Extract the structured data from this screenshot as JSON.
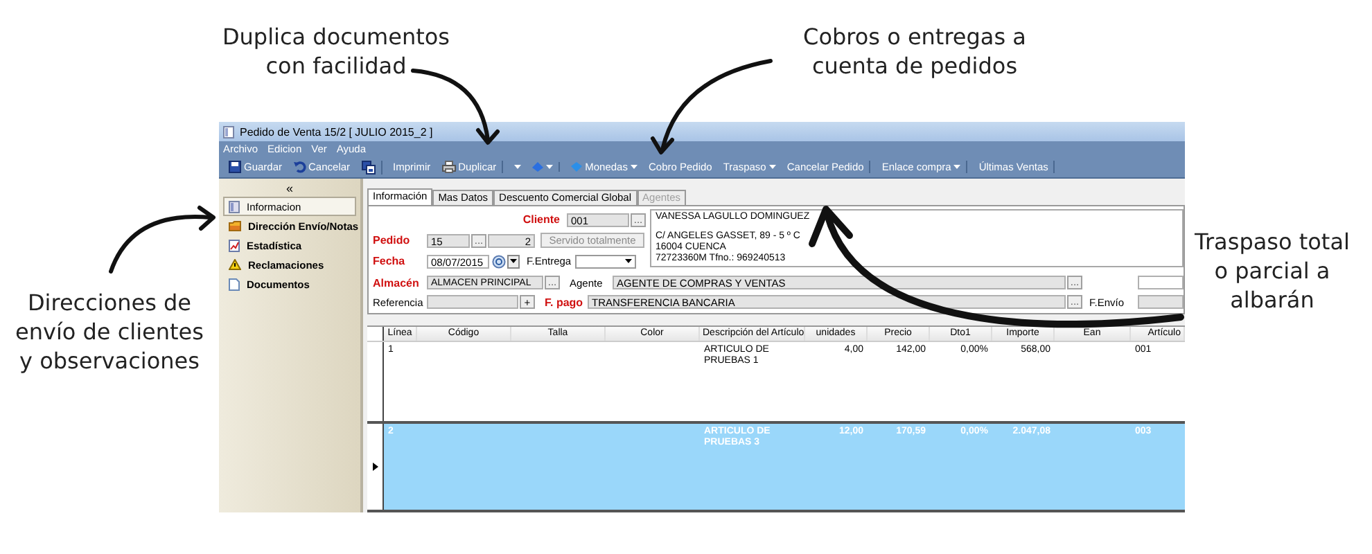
{
  "callouts": [
    {
      "lines": [
        "Duplica documentos",
        "con facilidad"
      ]
    },
    {
      "lines": [
        "Cobros o entregas a",
        "cuenta de pedidos"
      ]
    },
    {
      "lines": [
        "Traspaso total",
        "o parcial a",
        "albarán"
      ]
    },
    {
      "lines": [
        "Direcciones de",
        "envío de clientes",
        "y observaciones"
      ]
    }
  ],
  "window": {
    "title": "Pedido de Venta 15/2 [ JULIO 2015_2 ]"
  },
  "menu": [
    "Archivo",
    "Edicion",
    "Ver",
    "Ayuda"
  ],
  "toolbar": [
    {
      "label": "Guardar",
      "has_menu": false,
      "separator_after": false
    },
    {
      "label": "Cancelar",
      "has_menu": false,
      "separator_after": false
    },
    {
      "has_menu": false,
      "separator_after": true
    },
    {
      "label": "Imprimir",
      "has_menu": false,
      "separator_after": false
    },
    {
      "label": "Duplicar",
      "has_menu": false,
      "separator_after": true
    },
    {
      "has_menu": true,
      "separator_after": false
    },
    {
      "has_menu": true,
      "separator_after": true
    },
    {
      "label": "Monedas",
      "has_menu": true,
      "separator_after": false
    },
    {
      "label": "Cobro Pedido",
      "has_menu": false,
      "separator_after": false
    },
    {
      "label": "Traspaso",
      "has_menu": true,
      "separator_after": false
    },
    {
      "label": "Cancelar Pedido",
      "has_menu": false,
      "separator_after": true
    },
    {
      "label": "Enlace compra",
      "has_menu": true,
      "separator_after": true
    },
    {
      "label": "Últimas Ventas",
      "has_menu": false,
      "separator_after": true
    }
  ],
  "sidebar": {
    "collapse": "«",
    "items": [
      {
        "label": "Informacion",
        "selected": true
      },
      {
        "label": "Dirección Envío/Notas",
        "selected": false
      },
      {
        "label": "Estadística",
        "selected": false
      },
      {
        "label": "Reclamaciones",
        "selected": false
      },
      {
        "label": "Documentos",
        "selected": false
      }
    ]
  },
  "tabs": [
    {
      "label": "Información",
      "selected": true,
      "disabled": false
    },
    {
      "label": "Mas Datos",
      "selected": false,
      "disabled": false
    },
    {
      "label": "Descuento Comercial Global",
      "selected": false,
      "disabled": false
    },
    {
      "label": "Agentes",
      "selected": false,
      "disabled": true
    }
  ],
  "form": {
    "client": {
      "label": "Cliente",
      "required": true,
      "value": "001",
      "button": "..."
    },
    "address": [
      "VANESSA LAGULLO DOMINGUEZ",
      "C/ ANGELES GASSET, 89 - 5 º C",
      "16004 CUENCA",
      "72723360M   Tfno.: 969240513"
    ],
    "order": {
      "label": "Pedido",
      "required": true,
      "series": "15",
      "button": "...",
      "number": "2",
      "status_button": {
        "label": "Servido totalmente",
        "disabled": true
      }
    },
    "date": {
      "label": "Fecha",
      "required": true,
      "value": "08/07/2015"
    },
    "delivery_date": {
      "label": "F.Entrega",
      "required": false
    },
    "warehouse": {
      "label": "Almacén",
      "required": true,
      "value": "ALMACEN PRINCIPAL",
      "button": "..."
    },
    "agent": {
      "label": "Agente",
      "required": false,
      "value": "AGENTE DE COMPRAS Y VENTAS",
      "button": "..."
    },
    "reference": {
      "label": "Referencia",
      "required": false,
      "button": "+"
    },
    "payment": {
      "label": "F. pago",
      "required": true,
      "value": "TRANSFERENCIA BANCARIA",
      "button": "..."
    },
    "ship_date": {
      "label": "F.Envío",
      "required": false
    }
  },
  "grid": {
    "columns": [
      "Línea",
      "Código",
      "Talla",
      "Color",
      "Descripción del Artículo",
      "unidades",
      "Precio",
      "Dto1",
      "Importe",
      "Ean",
      "Artículo"
    ],
    "rows": [
      {
        "selected": false,
        "cells": [
          "1",
          null,
          null,
          null,
          "ARTICULO DE PRUEBAS 1",
          "4,00",
          "142,00",
          "0,00%",
          "568,00",
          null,
          "001"
        ]
      },
      {
        "selected": true,
        "cells": [
          "2",
          null,
          null,
          null,
          "ARTICULO DE PRUEBAS 3",
          "12,00",
          "170,59",
          "0,00%",
          "2.047,08",
          null,
          "003"
        ]
      }
    ]
  }
}
